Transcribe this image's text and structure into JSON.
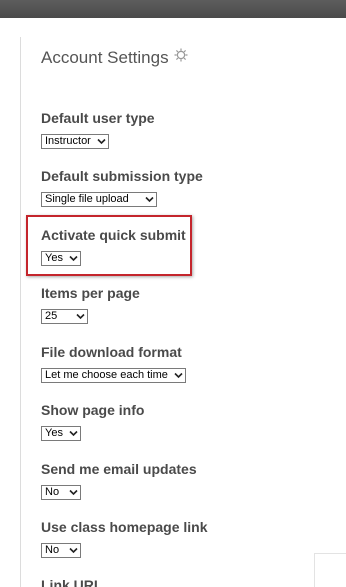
{
  "settings_panel": {
    "title": "Account Settings",
    "icons": {
      "settings": "gear-icon",
      "dropdown": "chevron-down-icon"
    },
    "colors": {
      "highlight_border": "#c4252c",
      "top_bar": "#4a4a4a"
    },
    "settings": [
      {
        "label": "Default user type",
        "value": "Instructor"
      },
      {
        "label": "Default submission type",
        "value": "Single file upload"
      },
      {
        "label": "Activate quick submit",
        "value": "Yes"
      },
      {
        "label": "Items per page",
        "value": "25"
      },
      {
        "label": "File download format",
        "value": "Let me choose each time"
      },
      {
        "label": "Show page info",
        "value": "Yes"
      },
      {
        "label": "Send me email updates",
        "value": "No"
      },
      {
        "label": "Use class homepage link",
        "value": "No"
      },
      {
        "label": "Link URL"
      }
    ]
  }
}
